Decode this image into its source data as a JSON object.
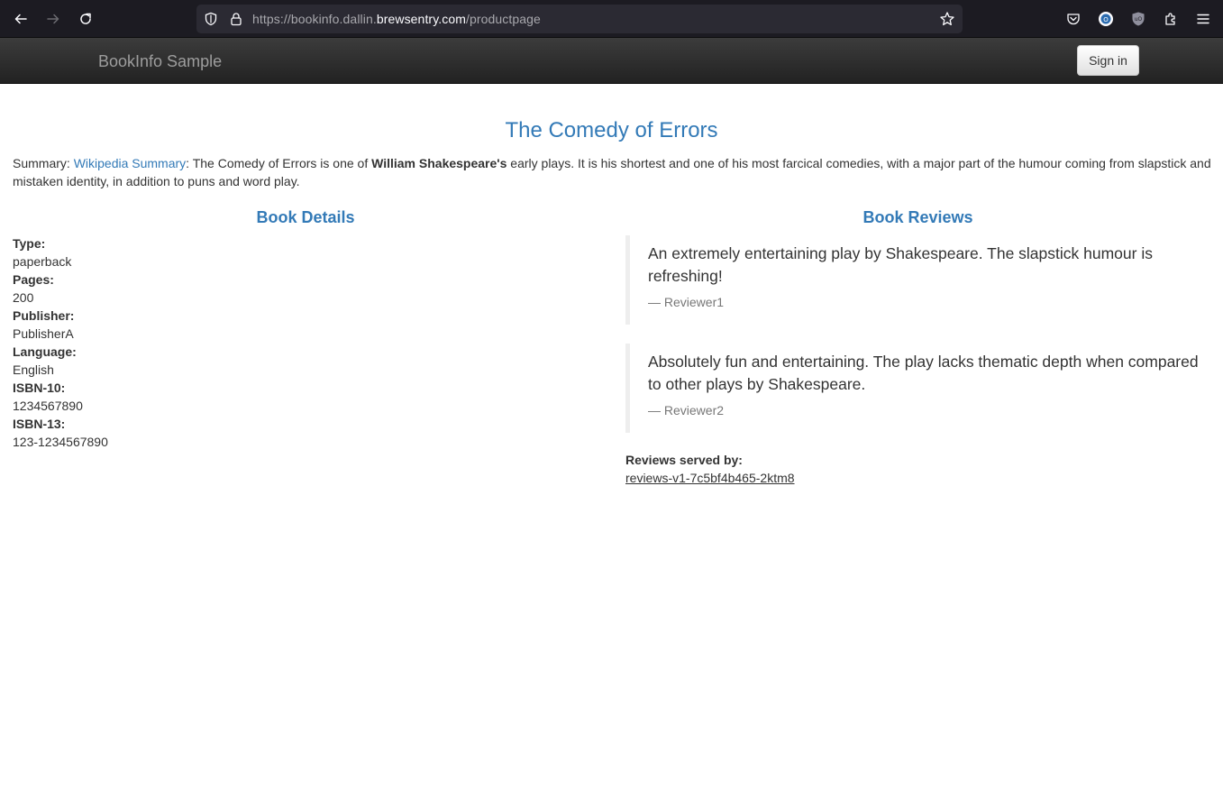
{
  "browser": {
    "url_prefix": "https://bookinfo.dallin.",
    "url_host": "brewsentry.com",
    "url_path": "/productpage"
  },
  "navbar": {
    "brand": "BookInfo Sample",
    "signin_label": "Sign in"
  },
  "book": {
    "title": "The Comedy of Errors",
    "summary_label": "Summary: ",
    "summary_link": "Wikipedia Summary",
    "summary_pre": ": The Comedy of Errors is one of ",
    "summary_bold": "William Shakespeare's",
    "summary_post": " early plays. It is his shortest and one of his most farcical comedies, with a major part of the humour coming from slapstick and mistaken identity, in addition to puns and word play."
  },
  "details": {
    "heading": "Book Details",
    "type_label": "Type:",
    "type_value": "paperback",
    "pages_label": "Pages:",
    "pages_value": "200",
    "publisher_label": "Publisher:",
    "publisher_value": "PublisherA",
    "language_label": "Language:",
    "language_value": "English",
    "isbn10_label": "ISBN-10:",
    "isbn10_value": "1234567890",
    "isbn13_label": "ISBN-13:",
    "isbn13_value": "123-1234567890"
  },
  "reviews": {
    "heading": "Book Reviews",
    "items": [
      {
        "text": "An extremely entertaining play by Shakespeare. The slapstick humour is refreshing!",
        "reviewer": "— Reviewer1"
      },
      {
        "text": "Absolutely fun and entertaining. The play lacks thematic depth when compared to other plays by Shakespeare.",
        "reviewer": "— Reviewer2"
      }
    ],
    "served_label": "Reviews served by:",
    "served_pod": "reviews-v1-7c5bf4b465-2ktm8"
  }
}
